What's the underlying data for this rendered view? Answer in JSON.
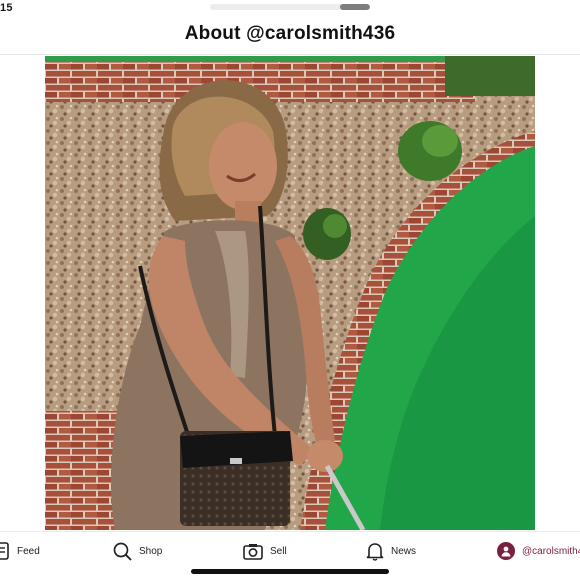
{
  "status_bar": {
    "time": "15"
  },
  "header": {
    "title": "About @carolsmith436"
  },
  "photo": {
    "icon": "profile-photo"
  },
  "tabbar": {
    "items": [
      {
        "label": "Feed",
        "icon": "feed-icon"
      },
      {
        "label": "Shop",
        "icon": "search-icon"
      },
      {
        "label": "Sell",
        "icon": "camera-icon"
      },
      {
        "label": "News",
        "icon": "bell-icon"
      },
      {
        "label": "@carolsmith4",
        "icon": "avatar-icon"
      }
    ]
  },
  "colors": {
    "accent": "#7a1f3d",
    "turf": "#22a64a",
    "brick": "#a8503a"
  }
}
